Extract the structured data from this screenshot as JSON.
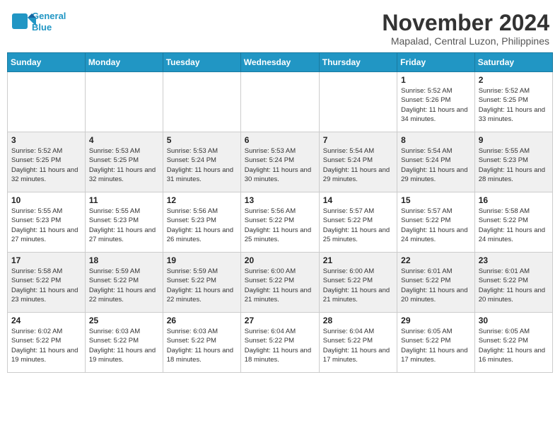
{
  "header": {
    "logo_line1": "General",
    "logo_line2": "Blue",
    "month": "November 2024",
    "location": "Mapalad, Central Luzon, Philippines"
  },
  "weekdays": [
    "Sunday",
    "Monday",
    "Tuesday",
    "Wednesday",
    "Thursday",
    "Friday",
    "Saturday"
  ],
  "weeks": [
    [
      {
        "day": "",
        "info": ""
      },
      {
        "day": "",
        "info": ""
      },
      {
        "day": "",
        "info": ""
      },
      {
        "day": "",
        "info": ""
      },
      {
        "day": "",
        "info": ""
      },
      {
        "day": "1",
        "info": "Sunrise: 5:52 AM\nSunset: 5:26 PM\nDaylight: 11 hours and 34 minutes."
      },
      {
        "day": "2",
        "info": "Sunrise: 5:52 AM\nSunset: 5:25 PM\nDaylight: 11 hours and 33 minutes."
      }
    ],
    [
      {
        "day": "3",
        "info": "Sunrise: 5:52 AM\nSunset: 5:25 PM\nDaylight: 11 hours and 32 minutes."
      },
      {
        "day": "4",
        "info": "Sunrise: 5:53 AM\nSunset: 5:25 PM\nDaylight: 11 hours and 32 minutes."
      },
      {
        "day": "5",
        "info": "Sunrise: 5:53 AM\nSunset: 5:24 PM\nDaylight: 11 hours and 31 minutes."
      },
      {
        "day": "6",
        "info": "Sunrise: 5:53 AM\nSunset: 5:24 PM\nDaylight: 11 hours and 30 minutes."
      },
      {
        "day": "7",
        "info": "Sunrise: 5:54 AM\nSunset: 5:24 PM\nDaylight: 11 hours and 29 minutes."
      },
      {
        "day": "8",
        "info": "Sunrise: 5:54 AM\nSunset: 5:24 PM\nDaylight: 11 hours and 29 minutes."
      },
      {
        "day": "9",
        "info": "Sunrise: 5:55 AM\nSunset: 5:23 PM\nDaylight: 11 hours and 28 minutes."
      }
    ],
    [
      {
        "day": "10",
        "info": "Sunrise: 5:55 AM\nSunset: 5:23 PM\nDaylight: 11 hours and 27 minutes."
      },
      {
        "day": "11",
        "info": "Sunrise: 5:55 AM\nSunset: 5:23 PM\nDaylight: 11 hours and 27 minutes."
      },
      {
        "day": "12",
        "info": "Sunrise: 5:56 AM\nSunset: 5:23 PM\nDaylight: 11 hours and 26 minutes."
      },
      {
        "day": "13",
        "info": "Sunrise: 5:56 AM\nSunset: 5:22 PM\nDaylight: 11 hours and 25 minutes."
      },
      {
        "day": "14",
        "info": "Sunrise: 5:57 AM\nSunset: 5:22 PM\nDaylight: 11 hours and 25 minutes."
      },
      {
        "day": "15",
        "info": "Sunrise: 5:57 AM\nSunset: 5:22 PM\nDaylight: 11 hours and 24 minutes."
      },
      {
        "day": "16",
        "info": "Sunrise: 5:58 AM\nSunset: 5:22 PM\nDaylight: 11 hours and 24 minutes."
      }
    ],
    [
      {
        "day": "17",
        "info": "Sunrise: 5:58 AM\nSunset: 5:22 PM\nDaylight: 11 hours and 23 minutes."
      },
      {
        "day": "18",
        "info": "Sunrise: 5:59 AM\nSunset: 5:22 PM\nDaylight: 11 hours and 22 minutes."
      },
      {
        "day": "19",
        "info": "Sunrise: 5:59 AM\nSunset: 5:22 PM\nDaylight: 11 hours and 22 minutes."
      },
      {
        "day": "20",
        "info": "Sunrise: 6:00 AM\nSunset: 5:22 PM\nDaylight: 11 hours and 21 minutes."
      },
      {
        "day": "21",
        "info": "Sunrise: 6:00 AM\nSunset: 5:22 PM\nDaylight: 11 hours and 21 minutes."
      },
      {
        "day": "22",
        "info": "Sunrise: 6:01 AM\nSunset: 5:22 PM\nDaylight: 11 hours and 20 minutes."
      },
      {
        "day": "23",
        "info": "Sunrise: 6:01 AM\nSunset: 5:22 PM\nDaylight: 11 hours and 20 minutes."
      }
    ],
    [
      {
        "day": "24",
        "info": "Sunrise: 6:02 AM\nSunset: 5:22 PM\nDaylight: 11 hours and 19 minutes."
      },
      {
        "day": "25",
        "info": "Sunrise: 6:03 AM\nSunset: 5:22 PM\nDaylight: 11 hours and 19 minutes."
      },
      {
        "day": "26",
        "info": "Sunrise: 6:03 AM\nSunset: 5:22 PM\nDaylight: 11 hours and 18 minutes."
      },
      {
        "day": "27",
        "info": "Sunrise: 6:04 AM\nSunset: 5:22 PM\nDaylight: 11 hours and 18 minutes."
      },
      {
        "day": "28",
        "info": "Sunrise: 6:04 AM\nSunset: 5:22 PM\nDaylight: 11 hours and 17 minutes."
      },
      {
        "day": "29",
        "info": "Sunrise: 6:05 AM\nSunset: 5:22 PM\nDaylight: 11 hours and 17 minutes."
      },
      {
        "day": "30",
        "info": "Sunrise: 6:05 AM\nSunset: 5:22 PM\nDaylight: 11 hours and 16 minutes."
      }
    ]
  ]
}
